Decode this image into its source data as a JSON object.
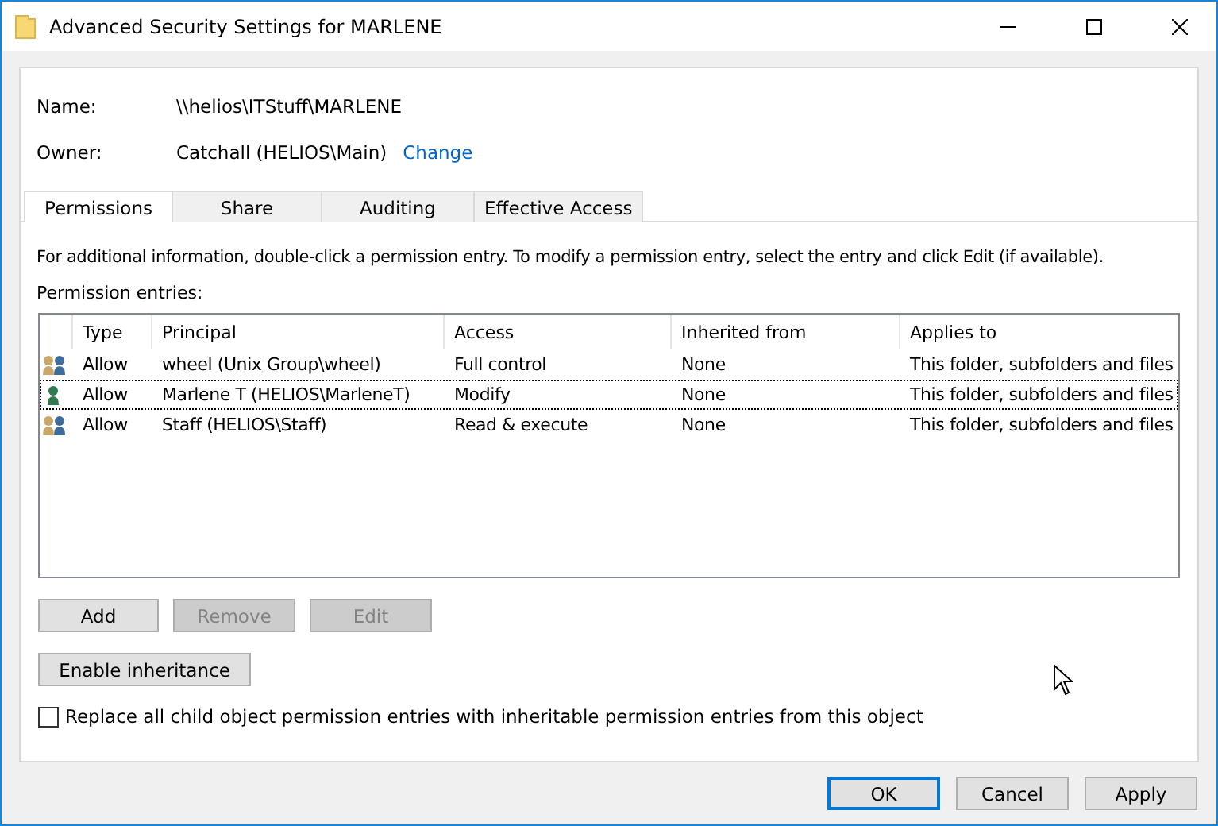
{
  "window": {
    "title": "Advanced Security Settings for MARLENE"
  },
  "name": {
    "label": "Name:",
    "value": "\\\\helios\\ITStuff\\MARLENE"
  },
  "owner": {
    "label": "Owner:",
    "value": "Catchall (HELIOS\\Main)",
    "link": "Change"
  },
  "tabs": [
    {
      "label": "Permissions",
      "selected": true
    },
    {
      "label": "Share",
      "selected": false
    },
    {
      "label": "Auditing",
      "selected": false
    },
    {
      "label": "Effective Access",
      "selected": false
    }
  ],
  "info": "For additional information, double-click a permission entry. To modify a permission entry, select the entry and click Edit (if available).",
  "entries_label": "Permission entries:",
  "table": {
    "columns": [
      "Type",
      "Principal",
      "Access",
      "Inherited from",
      "Applies to"
    ],
    "rows": [
      {
        "kind": "group",
        "focused": false,
        "cells": [
          "Allow",
          "wheel (Unix Group\\wheel)",
          "Full control",
          "None",
          "This folder, subfolders and files"
        ]
      },
      {
        "kind": "user",
        "focused": true,
        "cells": [
          "Allow",
          "Marlene T (HELIOS\\MarleneT)",
          "Modify",
          "None",
          "This folder, subfolders and files"
        ]
      },
      {
        "kind": "group",
        "focused": false,
        "cells": [
          "Allow",
          "Staff (HELIOS\\Staff)",
          "Read & execute",
          "None",
          "This folder, subfolders and files"
        ]
      }
    ]
  },
  "entry_buttons": [
    {
      "label": "Add",
      "disabled": false
    },
    {
      "label": "Remove",
      "disabled": true
    },
    {
      "label": "Edit",
      "disabled": true
    }
  ],
  "inheritance_button": "Enable inheritance",
  "replace_checkbox": {
    "label": "Replace all child object permission entries with inheritable permission entries from this object",
    "checked": false
  },
  "footer_buttons": [
    {
      "label": "OK",
      "default": true
    },
    {
      "label": "Cancel",
      "default": false
    },
    {
      "label": "Apply",
      "default": false
    }
  ]
}
